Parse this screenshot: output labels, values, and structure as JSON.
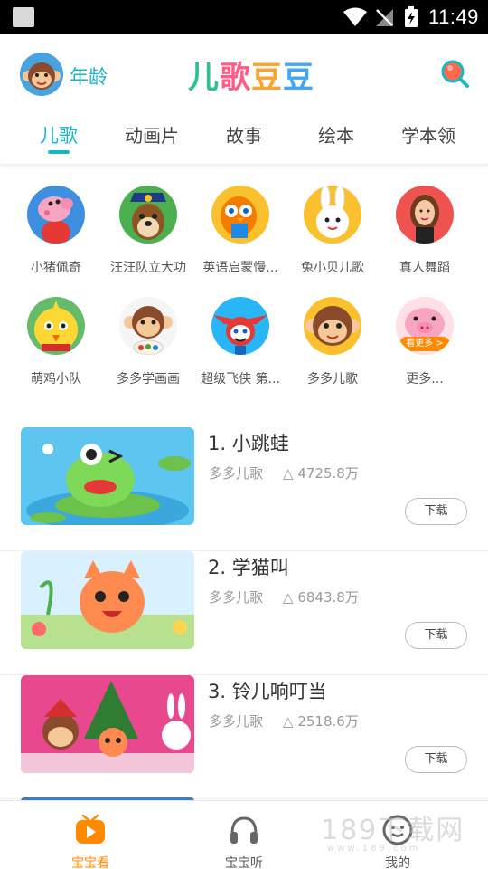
{
  "status_bar": {
    "time": "11:49"
  },
  "header": {
    "age_label": "年龄",
    "logo_parts": [
      "儿",
      "歌",
      "豆",
      "豆"
    ]
  },
  "tabs": [
    {
      "label": "儿歌",
      "active": true
    },
    {
      "label": "动画片",
      "active": false
    },
    {
      "label": "故事",
      "active": false
    },
    {
      "label": "绘本",
      "active": false
    },
    {
      "label": "学本领",
      "active": false
    }
  ],
  "categories": [
    {
      "label": "小猪佩奇",
      "icon": "peppa-pig-icon"
    },
    {
      "label": "汪汪队立大功",
      "icon": "paw-patrol-icon"
    },
    {
      "label": "英语启蒙慢...",
      "icon": "owl-english-icon"
    },
    {
      "label": "兔小贝儿歌",
      "icon": "rabbit-icon"
    },
    {
      "label": "真人舞蹈",
      "icon": "girl-dance-icon"
    },
    {
      "label": "萌鸡小队",
      "icon": "chick-icon"
    },
    {
      "label": "多多学画画",
      "icon": "monkey-painting-icon"
    },
    {
      "label": "超级飞侠 第...",
      "icon": "super-wings-icon"
    },
    {
      "label": "多多儿歌",
      "icon": "monkey-icon"
    },
    {
      "label": "更多...",
      "icon": "pig-more-icon",
      "badge": "看更多 >"
    }
  ],
  "songs": [
    {
      "title": "1. 小跳蛙",
      "artist": "多多儿歌",
      "plays": "4725.8万",
      "download": "下载"
    },
    {
      "title": "2. 学猫叫",
      "artist": "多多儿歌",
      "plays": "6843.8万",
      "download": "下载"
    },
    {
      "title": "3. 铃儿响叮当",
      "artist": "多多儿歌",
      "plays": "2518.6万",
      "download": "下载"
    }
  ],
  "bottom_nav": [
    {
      "label": "宝宝看",
      "active": true
    },
    {
      "label": "宝宝听",
      "active": false
    },
    {
      "label": "我的",
      "active": false
    }
  ],
  "watermark": {
    "main": "189下载网",
    "sub": "www.189.com"
  },
  "colors": {
    "accent": "#19b6c7",
    "nav_active": "#ff8a00"
  }
}
